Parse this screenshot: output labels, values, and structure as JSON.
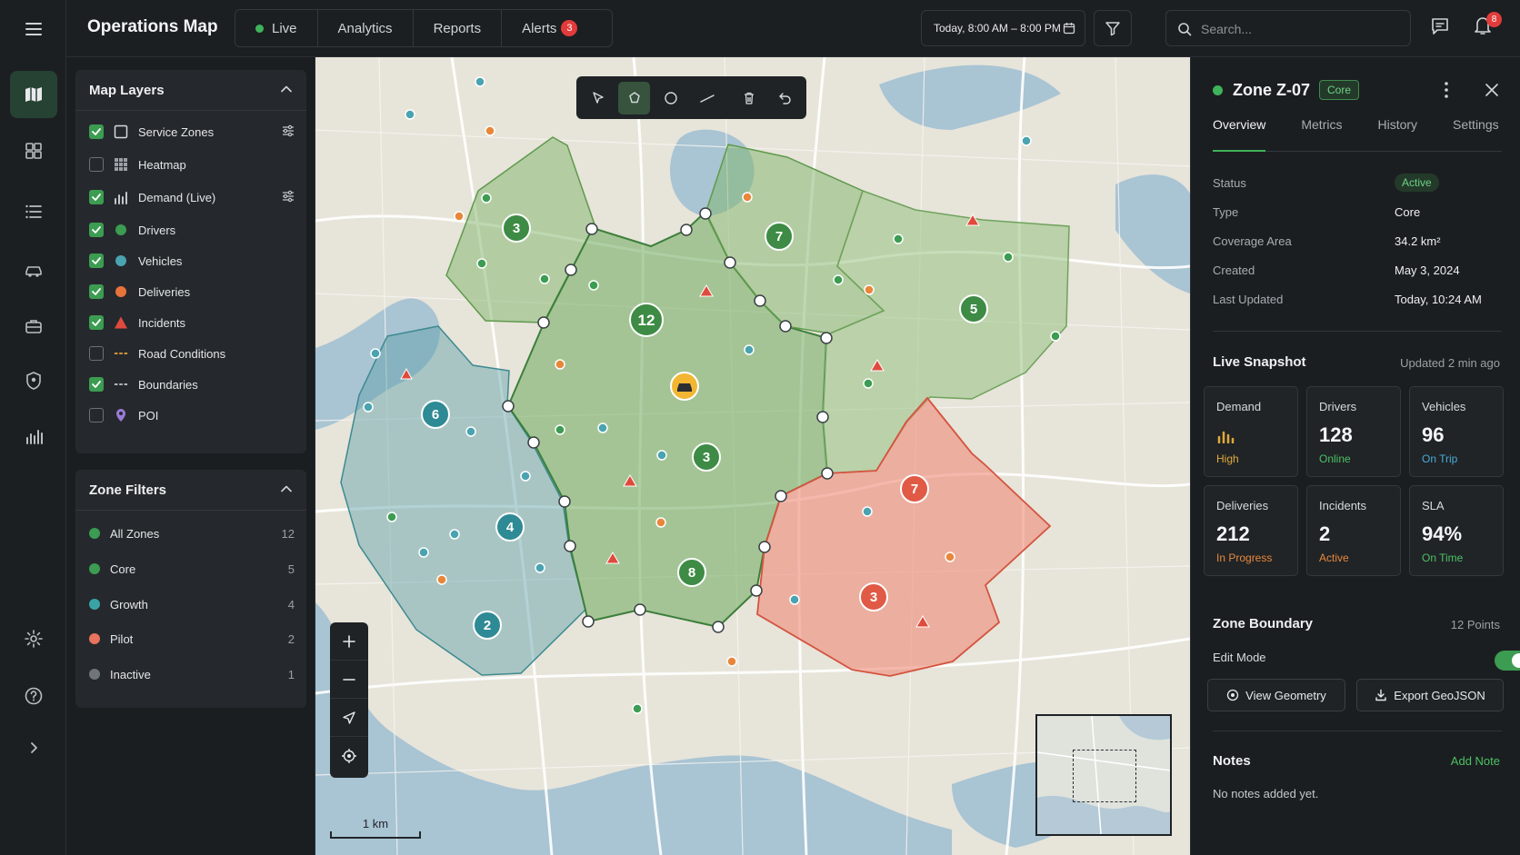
{
  "app": {
    "title": "Operations Map"
  },
  "nav": {
    "tabs": [
      {
        "label": "Live"
      },
      {
        "label": "Analytics"
      },
      {
        "label": "Reports"
      },
      {
        "label": "Alerts",
        "badge": "3"
      }
    ],
    "date_range": "Today, 8:00 AM – 8:00 PM",
    "search_placeholder": "Search...",
    "notification_count": "8"
  },
  "layers": {
    "title": "Map Layers",
    "items": [
      {
        "label": "Service Zones",
        "checked": true,
        "icon": "square-outline-icon"
      },
      {
        "label": "Heatmap",
        "checked": false,
        "icon": "grid-icon"
      },
      {
        "label": "Demand (Live)",
        "checked": true,
        "icon": "bar-chart-icon"
      },
      {
        "label": "Drivers",
        "checked": true,
        "icon": "green-dot-icon"
      },
      {
        "label": "Vehicles",
        "checked": true,
        "icon": "teal-dot-icon"
      },
      {
        "label": "Deliveries",
        "checked": true,
        "icon": "orange-dot-icon"
      },
      {
        "label": "Incidents",
        "checked": true,
        "icon": "red-triangle-icon"
      },
      {
        "label": "Road Conditions",
        "checked": false,
        "icon": "orange-dash-icon"
      },
      {
        "label": "Boundaries",
        "checked": true,
        "icon": "gray-dash-icon"
      },
      {
        "label": "POI",
        "checked": false,
        "icon": "pin-icon"
      }
    ]
  },
  "zone_filters": {
    "title": "Zone Filters",
    "items": [
      {
        "label": "All Zones",
        "count": "12",
        "color": "#3c9c51"
      },
      {
        "label": "Core",
        "count": "5",
        "color": "#3c9c51"
      },
      {
        "label": "Growth",
        "count": "4",
        "color": "#3aa3a6"
      },
      {
        "label": "Pilot",
        "count": "2",
        "color": "#e8735e"
      },
      {
        "label": "Inactive",
        "count": "1",
        "color": "#6f757a"
      }
    ]
  },
  "map": {
    "scale_label": "1 km",
    "clusters": [
      "3",
      "7",
      "12",
      "5",
      "6",
      "3",
      "4",
      "8",
      "2",
      "7",
      "3"
    ]
  },
  "detail": {
    "zone_name": "Zone Z-07",
    "zone_badge": "Core",
    "tabs": [
      "Overview",
      "Metrics",
      "History",
      "Settings"
    ],
    "fields": [
      {
        "label": "Status",
        "value": "Active"
      },
      {
        "label": "Type",
        "value": "Core"
      },
      {
        "label": "Coverage Area",
        "value": "34.2 km²"
      },
      {
        "label": "Created",
        "value": "May 3, 2024"
      },
      {
        "label": "Last Updated",
        "value": "Today, 10:24 AM"
      }
    ],
    "snapshot": {
      "title": "Live Snapshot",
      "updated": "Updated 2 min ago",
      "metrics": [
        {
          "label": "Demand",
          "value": "",
          "sub": "High",
          "sub_color": "#e0a93a"
        },
        {
          "label": "Drivers",
          "value": "128",
          "sub": "Online",
          "sub_color": "#4cc063"
        },
        {
          "label": "Vehicles",
          "value": "96",
          "sub": "On Trip",
          "sub_color": "#4aa9d6"
        },
        {
          "label": "Deliveries",
          "value": "212",
          "sub": "In Progress",
          "sub_color": "#e8873a"
        },
        {
          "label": "Incidents",
          "value": "2",
          "sub": "Active",
          "sub_color": "#e8873a"
        },
        {
          "label": "SLA",
          "value": "94%",
          "sub": "On Time",
          "sub_color": "#4cc063"
        }
      ]
    },
    "boundary": {
      "title": "Zone Boundary",
      "points": "12 Points",
      "edit_mode_label": "Edit Mode",
      "edit_mode": true,
      "view_geometry": "View Geometry",
      "export_geojson": "Export GeoJSON"
    },
    "notes": {
      "title": "Notes",
      "add": "Add Note",
      "empty": "No notes added yet."
    }
  }
}
